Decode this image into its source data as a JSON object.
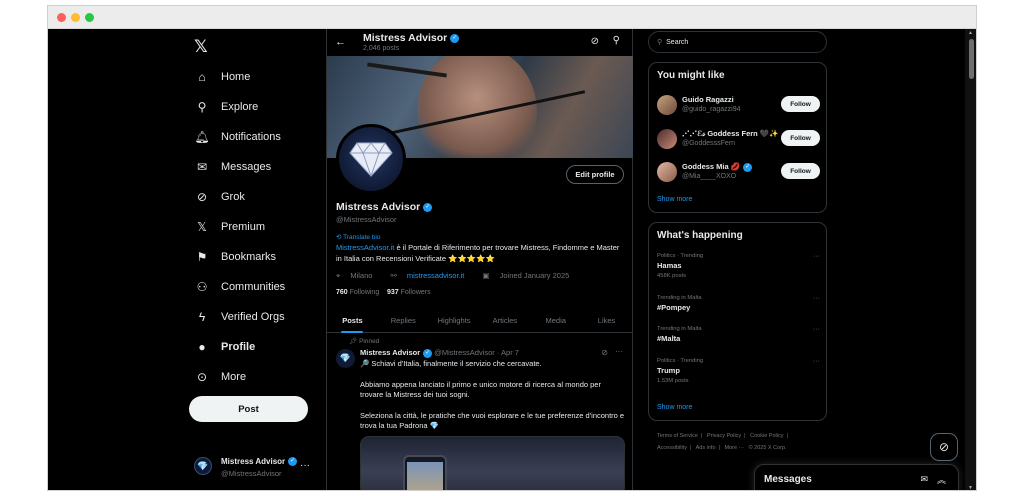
{
  "nav": {
    "logo": "𝕏",
    "items": [
      {
        "label": "Home",
        "icon": "⌂"
      },
      {
        "label": "Explore",
        "icon": "⚲"
      },
      {
        "label": "Notifications",
        "icon": "🔔︎"
      },
      {
        "label": "Messages",
        "icon": "✉"
      },
      {
        "label": "Grok",
        "icon": "⊘"
      },
      {
        "label": "Premium",
        "icon": "𝕏"
      },
      {
        "label": "Bookmarks",
        "icon": "⚑"
      },
      {
        "label": "Communities",
        "icon": "⚇"
      },
      {
        "label": "Verified Orgs",
        "icon": "ϟ"
      },
      {
        "label": "Profile",
        "icon": "●"
      },
      {
        "label": "More",
        "icon": "⊙"
      }
    ],
    "post_label": "Post",
    "account": {
      "name": "Mistress Advisor",
      "handle": "@MistressAdvisor",
      "more": "···"
    }
  },
  "topbar": {
    "title": "Mistress Advisor",
    "subtitle": "2,046 posts",
    "back": "←"
  },
  "profile": {
    "name": "Mistress Advisor",
    "handle": "@MistressAdvisor",
    "edit_label": "Edit profile",
    "translate": "Translate bio",
    "bio_link": "MistressAdvisor.it",
    "bio_text": " è il Portale di Riferimento per trovare Mistress, Findomme e Master in Italia con Recensioni Verificate ⭐⭐⭐⭐⭐",
    "location": "Milano",
    "website": "mistressadvisor.it",
    "joined": "Joined January 2025",
    "following_count": "760",
    "following_label": "Following",
    "followers_count": "937",
    "followers_label": "Followers"
  },
  "tabs": [
    "Posts",
    "Replies",
    "Highlights",
    "Articles",
    "Media",
    "Likes"
  ],
  "tweet": {
    "pinned_label": "Pinned",
    "name": "Mistress Advisor",
    "meta": "@MistressAdvisor · Apr 7",
    "lines": [
      "🔎 Schiavi d'Italia, finalmente il servizio che cercavate.",
      "Abbiamo appena lanciato il primo e unico motore di ricerca al mondo per trovare la Mistress dei tuoi sogni.",
      "Seleziona la città, le pratiche che vuoi esplorare e le tue preferenze d'incontro e trova la tua Padrona 💎"
    ]
  },
  "sidebar": {
    "search_placeholder": "Search",
    "you_might_like": "You might like",
    "suggestions": [
      {
        "name": "Guido Ragazzi",
        "handle": "@guido_ragazzi94",
        "follow": "Follow"
      },
      {
        "name": "⋰⋰ℰ𝓈 Goddess Fern 🖤✨",
        "handle": "@GoddesssFern",
        "follow": "Follow"
      },
      {
        "name": "Goddess Mia 💋",
        "handle": "@Mia____XOXO",
        "follow": "Follow"
      }
    ],
    "show_more": "Show more",
    "whats_happening": "What's happening",
    "trends": [
      {
        "context": "Politics · Trending",
        "name": "Hamas",
        "posts": "458K posts"
      },
      {
        "context": "Trending in Malta",
        "name": "#Pompey",
        "posts": ""
      },
      {
        "context": "Trending in Malta",
        "name": "#Malta",
        "posts": ""
      },
      {
        "context": "Politics · Trending",
        "name": "Trump",
        "posts": "1.53M posts"
      }
    ],
    "show_more2": "Show more",
    "footer": [
      "Terms of Service",
      "|",
      "Privacy Policy",
      "|",
      "Cookie Policy",
      "|",
      "Accessibility",
      "|",
      "Ads info",
      "|",
      "More ···",
      "© 2025 X Corp."
    ]
  },
  "messages_drawer": {
    "title": "Messages"
  }
}
